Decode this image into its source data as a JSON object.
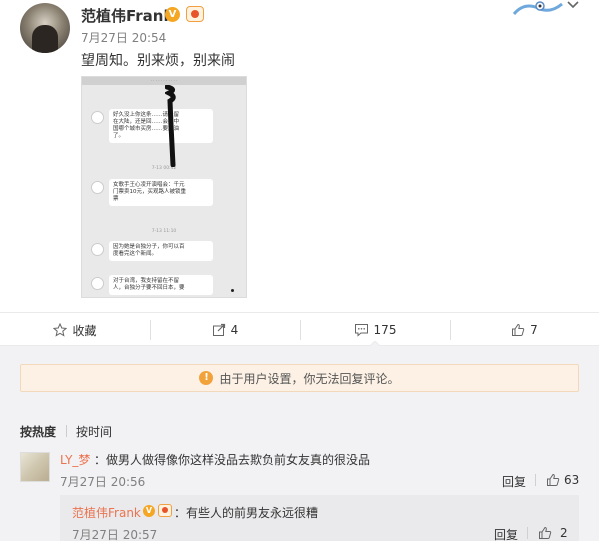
{
  "post": {
    "username": "范植伟Frank",
    "verified_icon": "v-verified-icon",
    "timestamp": "7月27日 20:54",
    "text": "望周知。别来烦，别来闹",
    "image": {
      "messages": [
        {
          "text": "好久没上你这条……请来留\n在大陆，还是回……会在中\n国哪个城市买房……要加油\n了。"
        },
        {
          "text": "女歌手王心凌开演唱会：千元\n门票卖10元，买观路人被锁重\n票"
        },
        {
          "text": "因为她是台独分子，你可以百\n度看完这个新闻。"
        },
        {
          "text": "对于台湾，我支持留在不留\n人，台独分子要不回日本，要"
        }
      ],
      "times": [
        "7-13 00:42",
        "7-13 11:10"
      ]
    }
  },
  "actions": {
    "favorite_label": "收藏",
    "repost_count": "4",
    "comment_count": "175",
    "like_count": "7"
  },
  "notice": {
    "text": "由于用户设置，你无法回复评论。"
  },
  "sort": {
    "hot": "按热度",
    "time": "按时间"
  },
  "comments": [
    {
      "username": "LY_梦",
      "text": "：做男人做得像你这样没品去欺负前女友真的很没品",
      "timestamp": "7月27日 20:56",
      "reply_label": "回复",
      "likes": "63",
      "replies": [
        {
          "username": "范植伟Frank",
          "text": "：有些人的前男友永远很糟",
          "timestamp": "7月27日 20:57",
          "reply_label": "回复",
          "likes": "2"
        }
      ]
    }
  ],
  "colors": {
    "link": "#eb7350",
    "notice_bg": "#fcf1e4",
    "warn": "#f2a23b",
    "verified": "#f5a623"
  }
}
